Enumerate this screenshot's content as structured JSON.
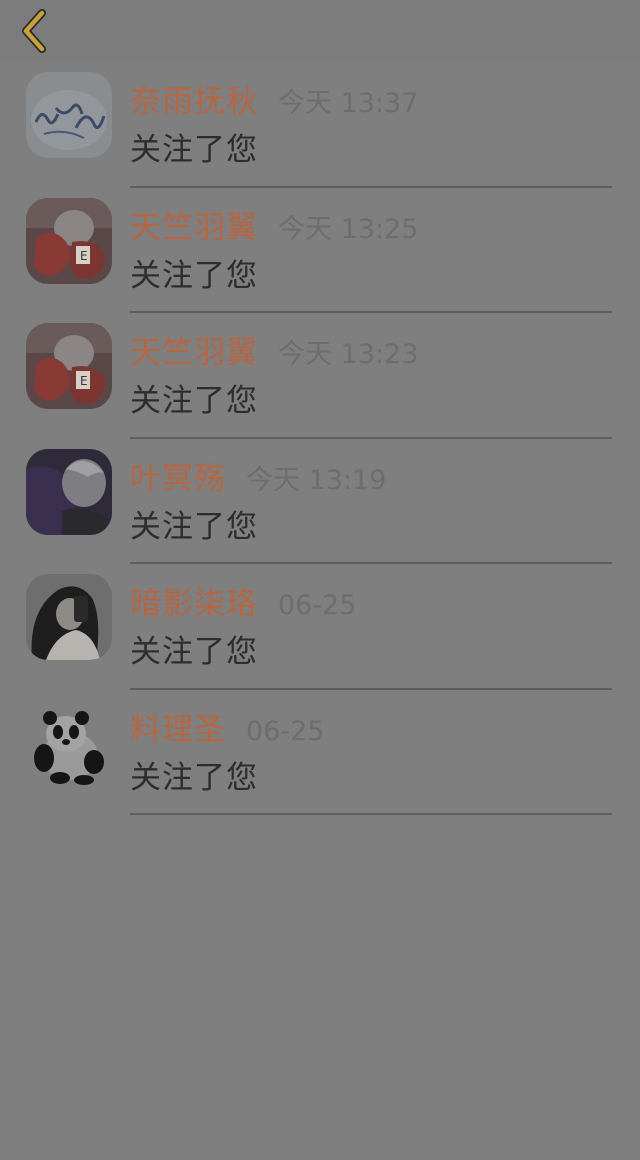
{
  "header": {
    "back_icon": "chevron-left-icon",
    "accent_color": "#c7a23a"
  },
  "colors": {
    "background": "#7f7f7f",
    "name": "#b56642",
    "time": "#6d6d6d",
    "action": "#2d2d2d"
  },
  "notifications": [
    {
      "name": "奈雨抚秋",
      "time": "今天 13:37",
      "action": "关注了您",
      "avatar": "calligraphy-avatar"
    },
    {
      "name": "天竺羽翼",
      "time": "今天 13:25",
      "action": "关注了您",
      "avatar": "anime-avatar-red"
    },
    {
      "name": "天竺羽翼",
      "time": "今天 13:23",
      "action": "关注了您",
      "avatar": "anime-avatar-red"
    },
    {
      "name": "叶冥殇",
      "time": "今天 13:19",
      "action": "关注了您",
      "avatar": "anime-avatar-dark"
    },
    {
      "name": "暗影柒珞",
      "time": "06-25",
      "action": "关注了您",
      "avatar": "photo-avatar-girl"
    },
    {
      "name": "料理圣",
      "time": "06-25",
      "action": "关注了您",
      "avatar": "panda-avatar"
    }
  ]
}
